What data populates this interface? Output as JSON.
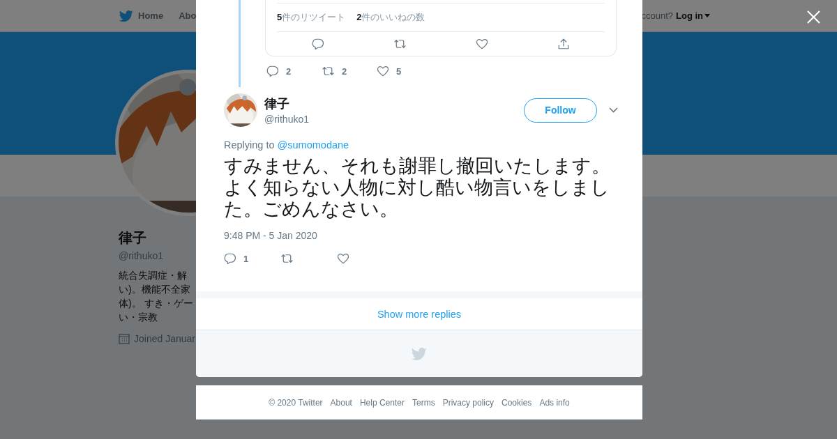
{
  "header": {
    "nav": [
      {
        "kind": "home",
        "label": "Home"
      },
      {
        "kind": "text",
        "label": "Abo"
      }
    ],
    "account_prompt": "ccount?",
    "login": "Log in"
  },
  "profile": {
    "name": "律子",
    "handle": "@rithuko1",
    "bio_lines": [
      "統合失調症・解",
      "い)。機能不全家",
      "体)。 すき・ゲー",
      "い・宗教"
    ],
    "joined": "Joined Januar"
  },
  "quoted_card": {
    "stats": [
      "**5**件のリツイート",
      "**2**件のいいねの数"
    ],
    "actions": [
      {
        "kind": "reply"
      },
      {
        "kind": "retweet"
      },
      {
        "kind": "like"
      },
      {
        "kind": "share"
      }
    ]
  },
  "parent_actions": [
    {
      "kind": "reply",
      "count": "2"
    },
    {
      "kind": "retweet",
      "count": "2"
    },
    {
      "kind": "like",
      "count": "5"
    }
  ],
  "tweet": {
    "name": "律子",
    "handle": "@rithuko1",
    "follow": "Follow",
    "replying_prefix": "Replying to",
    "replying_to": "@sumomodane",
    "text": "すみません、それも謝罪し撤回いたします。よく知らない人物に対し酷い物言いをしました。ごめんなさい。",
    "timestamp": "9:48 PM - 5 Jan 2020",
    "actions": [
      {
        "kind": "reply",
        "count": "1"
      },
      {
        "kind": "retweet"
      },
      {
        "kind": "like"
      }
    ]
  },
  "show_more": "Show more replies",
  "footer": [
    "© 2020 Twitter",
    "About",
    "Help Center",
    "Terms",
    "Privacy policy",
    "Cookies",
    "Ads info"
  ]
}
